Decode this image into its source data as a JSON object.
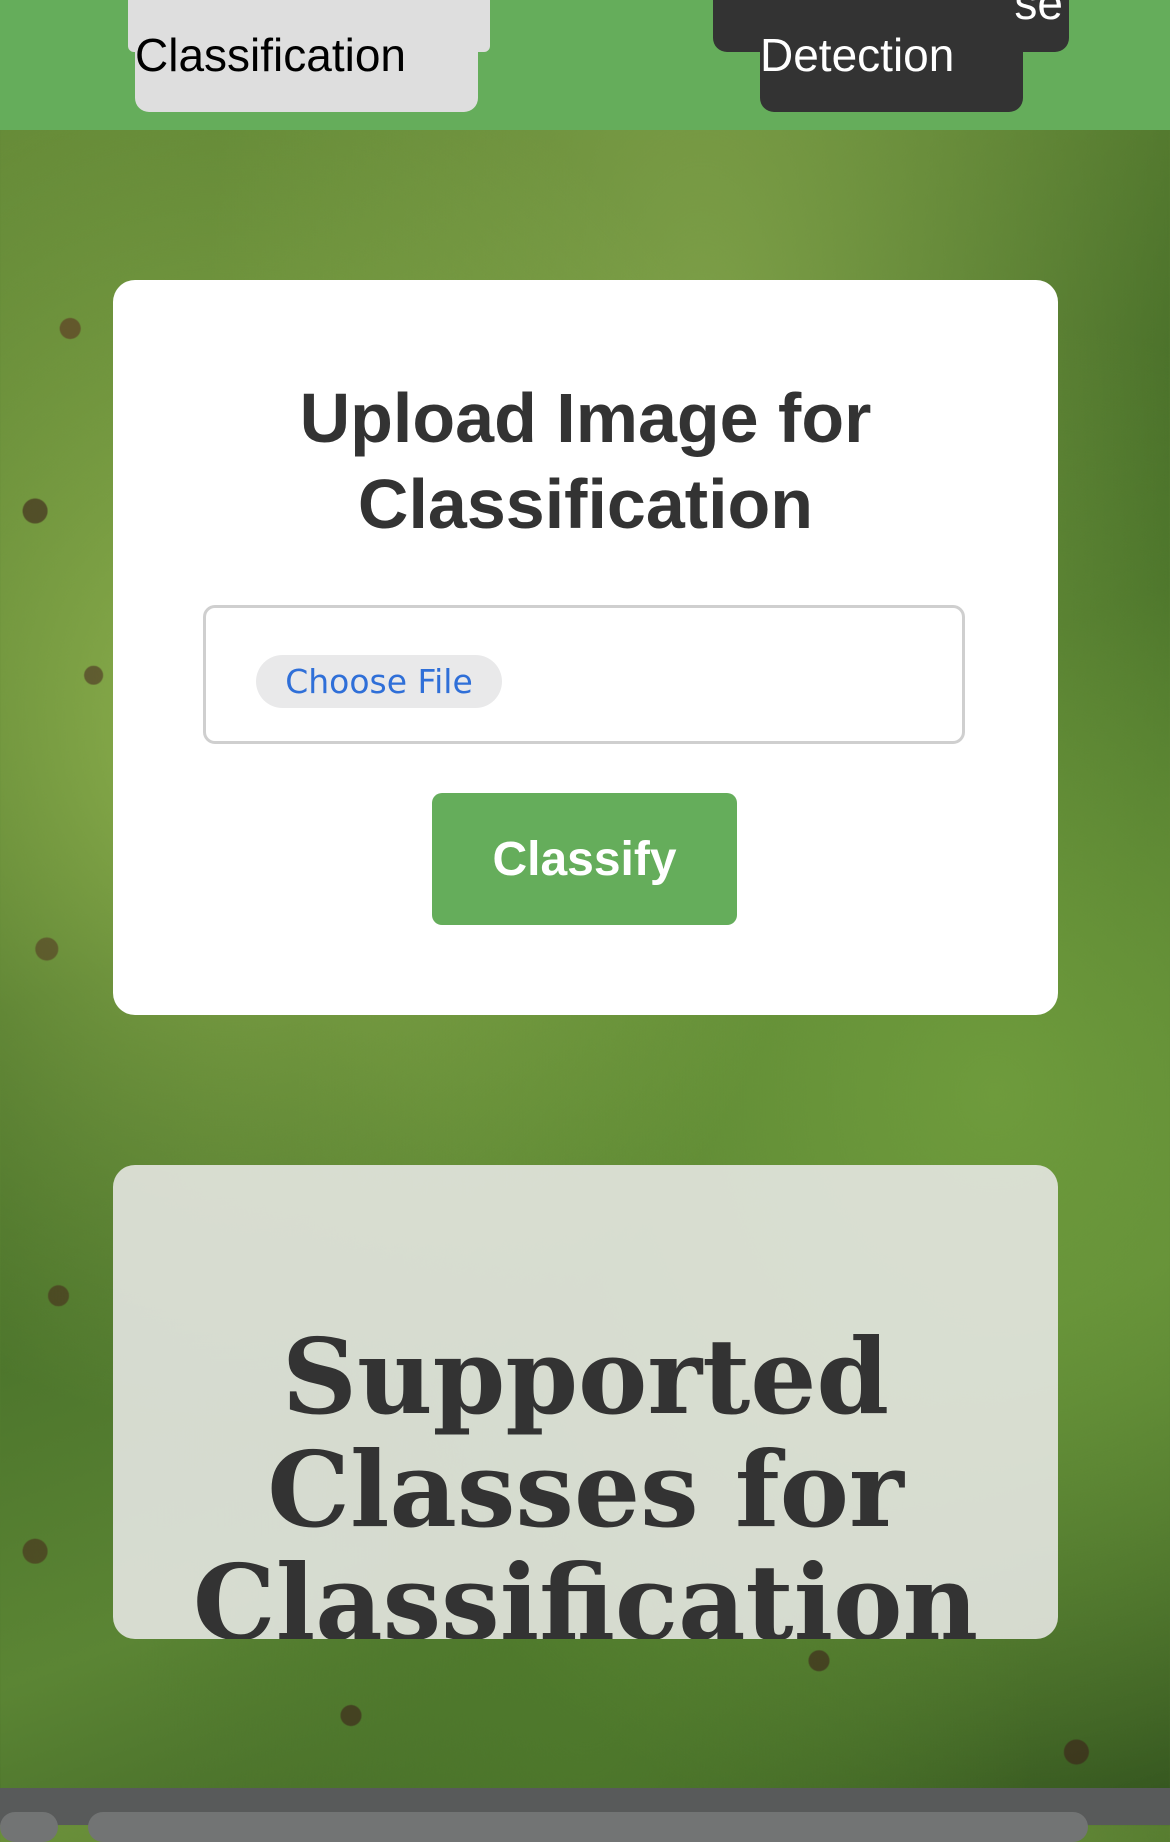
{
  "nav": {
    "classification_label": "Classification",
    "detection_label": "Detection",
    "detection_fragment": "se"
  },
  "upload": {
    "title": "Upload Image for Classification",
    "choose_file_label": "Choose File",
    "classify_label": "Classify"
  },
  "classes": {
    "title": "Supported Classes for Classification"
  },
  "colors": {
    "accent": "#65ad5b",
    "dark": "#333333"
  }
}
